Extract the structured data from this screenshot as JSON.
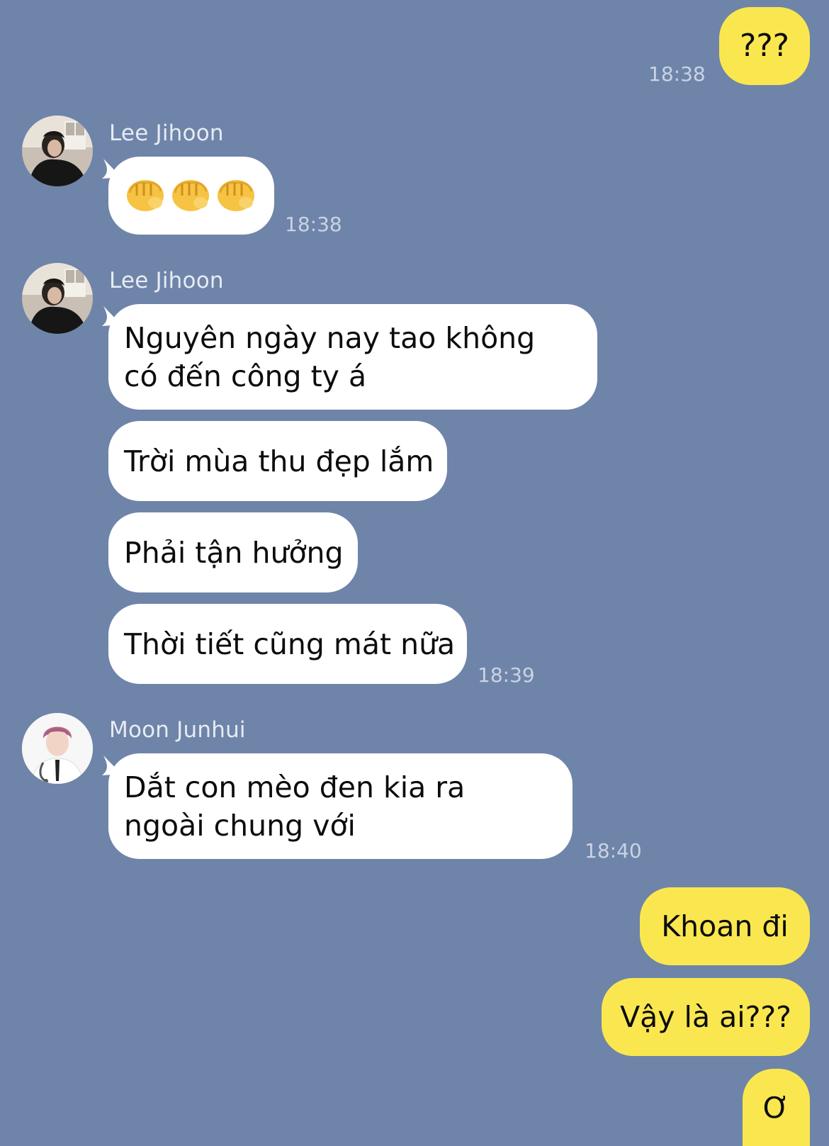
{
  "messages": [
    {
      "id": "m1",
      "side": "out",
      "text": "???",
      "time": "18:38"
    },
    {
      "id": "m2",
      "side": "in",
      "sender": "Lee Jihoon",
      "emoji_icon": "fist-bump-icon",
      "emoji_count": 3,
      "time": "18:38"
    },
    {
      "id": "m3",
      "side": "in",
      "sender": "Lee Jihoon",
      "texts": [
        "Nguyên ngày nay tao không có đến công ty á",
        "Trời mùa thu đẹp lắm",
        "Phải tận hưởng",
        "Thời tiết cũng mát nữa"
      ],
      "time": "18:39"
    },
    {
      "id": "m4",
      "side": "in",
      "sender": "Moon Junhui",
      "texts": [
        "Dắt con mèo đen kia ra ngoài chung với"
      ],
      "time": "18:40"
    },
    {
      "id": "m5",
      "side": "out",
      "texts": [
        "Khoan đi",
        "Vậy là ai???",
        "Ơ"
      ]
    }
  ],
  "colors": {
    "background": "#6f84a9",
    "incoming_bubble": "#ffffff",
    "outgoing_bubble": "#fae74f",
    "timestamp": "#c9d3e4",
    "sender_name": "#e6ebf3"
  },
  "icons": {
    "avatar_lee": "avatar-lee-jihoon",
    "avatar_moon": "avatar-moon-junhui",
    "emoji": "fist-bump-icon"
  }
}
